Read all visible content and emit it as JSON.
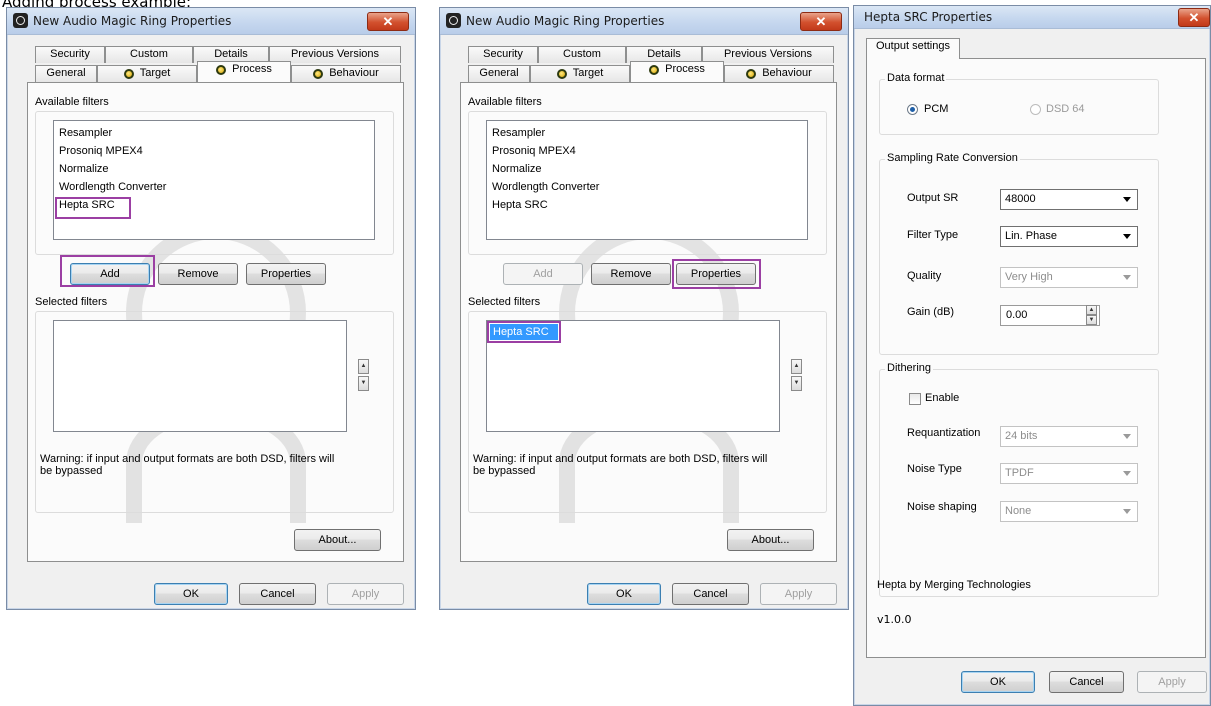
{
  "caption": "Adding process example:",
  "colors": {
    "highlight": "#9b3fa3",
    "selection": "#3399ff"
  },
  "dialog_left": {
    "title": "New Audio Magic Ring Properties",
    "tabs_row1": [
      "Security",
      "Custom",
      "Details",
      "Previous Versions"
    ],
    "tabs_row2": [
      "General",
      "Target",
      "Process",
      "Behaviour"
    ],
    "available_label": "Available filters",
    "available_filters": [
      "Resampler",
      "Prosoniq MPEX4",
      "Normalize",
      "Wordlength Converter",
      "Hepta SRC"
    ],
    "add": "Add",
    "remove": "Remove",
    "properties": "Properties",
    "selected_label": "Selected filters",
    "warning": "Warning: if input and output formats are both DSD, filters will be bypassed",
    "about": "About...",
    "ok": "OK",
    "cancel": "Cancel",
    "apply": "Apply"
  },
  "dialog_middle": {
    "title": "New Audio Magic Ring Properties",
    "tabs_row1": [
      "Security",
      "Custom",
      "Details",
      "Previous Versions"
    ],
    "tabs_row2": [
      "General",
      "Target",
      "Process",
      "Behaviour"
    ],
    "available_label": "Available filters",
    "available_filters": [
      "Resampler",
      "Prosoniq MPEX4",
      "Normalize",
      "Wordlength Converter",
      "Hepta SRC"
    ],
    "add": "Add",
    "remove": "Remove",
    "properties": "Properties",
    "selected_label": "Selected filters",
    "selected_filters": [
      "Hepta SRC"
    ],
    "warning": "Warning: if input and output formats are both DSD, filters will be bypassed",
    "about": "About...",
    "ok": "OK",
    "cancel": "Cancel",
    "apply": "Apply"
  },
  "dialog_right": {
    "title": "Hepta SRC Properties",
    "tab": "Output settings",
    "data_format": {
      "label": "Data format",
      "pcm": "PCM",
      "dsd": "DSD 64"
    },
    "src": {
      "label": "Sampling Rate Conversion",
      "output_sr_label": "Output SR",
      "output_sr_value": "48000",
      "filter_type_label": "Filter Type",
      "filter_type_value": "Lin. Phase",
      "quality_label": "Quality",
      "quality_value": "Very High",
      "gain_label": "Gain (dB)",
      "gain_value": "0.00"
    },
    "dithering": {
      "label": "Dithering",
      "enable": "Enable",
      "requant_label": "Requantization",
      "requant_value": "24 bits",
      "noise_type_label": "Noise Type",
      "noise_type_value": "TPDF",
      "noise_shaping_label": "Noise shaping",
      "noise_shaping_value": "None"
    },
    "footer": "Hepta by Merging Technologies",
    "version": "v1.0.0",
    "ok": "OK",
    "cancel": "Cancel",
    "apply": "Apply"
  }
}
